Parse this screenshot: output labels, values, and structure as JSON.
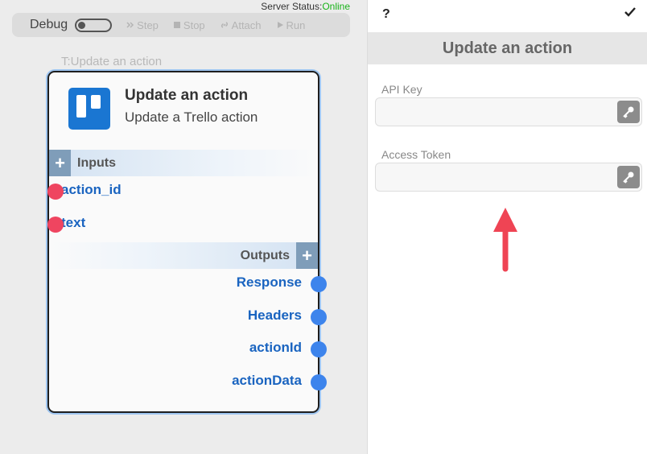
{
  "server": {
    "label": "Server Status:",
    "status": "Online"
  },
  "debugbar": {
    "debug_label": "Debug",
    "buttons": [
      {
        "label": "Step",
        "icon": "step-icon"
      },
      {
        "label": "Stop",
        "icon": "stop-icon"
      },
      {
        "label": "Attach",
        "icon": "link-icon"
      },
      {
        "label": "Run",
        "icon": "play-icon"
      }
    ]
  },
  "node": {
    "caption": "T:Update an action",
    "title": "Update an action",
    "subtitle": "Update a Trello action",
    "icon": "trello-icon",
    "inputs_label": "Inputs",
    "outputs_label": "Outputs",
    "inputs": [
      "action_id",
      "text"
    ],
    "outputs": [
      "Response",
      "Headers",
      "actionId",
      "actionData"
    ]
  },
  "panel": {
    "help_label": "?",
    "title": "Update an action",
    "fields": [
      {
        "label": "API Key",
        "value": "",
        "icon": "key-icon"
      },
      {
        "label": "Access Token",
        "value": "",
        "icon": "key-icon"
      }
    ]
  },
  "colors": {
    "accent": "#1a64c0",
    "input_port": "#ef4560",
    "output_port": "#3d84ec",
    "annotation_arrow": "#ef4454",
    "online": "#19b219"
  }
}
